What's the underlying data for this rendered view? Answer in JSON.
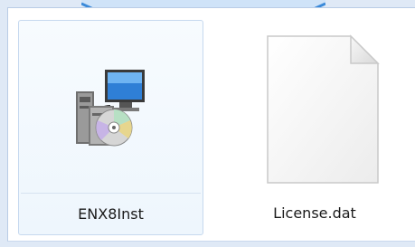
{
  "files": [
    {
      "name": "ENX8Inst",
      "icon": "installer-icon",
      "selected": true
    },
    {
      "name": "License.dat",
      "icon": "blank-document-icon",
      "selected": false
    }
  ],
  "colors": {
    "background": "#dfe9f6",
    "accent": "#3b8ad9",
    "selection_border": "#c6d9ef"
  }
}
